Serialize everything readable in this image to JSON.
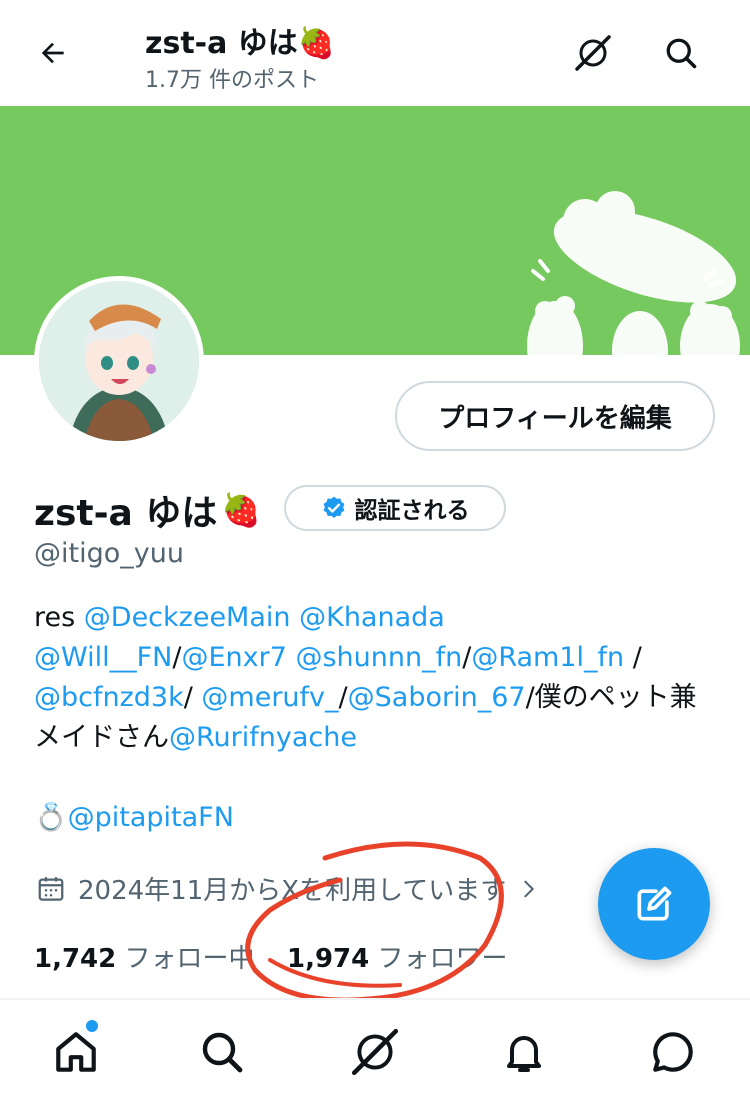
{
  "header": {
    "title": "zst-a ゆは",
    "title_emoji": "🍓",
    "post_count": "1.7万 件のポスト",
    "icons": [
      "back-arrow-icon",
      "grok-icon",
      "search-icon"
    ]
  },
  "profile": {
    "edit_button": "プロフィールを編集",
    "display_name": "zst-a ゆは",
    "name_emoji": "🍓",
    "verified_label": "認証される",
    "handle": "@itigo_yuu"
  },
  "bio": {
    "line1": [
      {
        "text": "res ",
        "link": false
      },
      {
        "text": "@DeckzeeMain",
        "link": true
      },
      {
        "text": " ",
        "link": false
      },
      {
        "text": "@Khanada",
        "link": true
      }
    ],
    "line2": [
      {
        "text": "@Will__FN",
        "link": true
      },
      {
        "text": "/",
        "link": false
      },
      {
        "text": "@Enxr7",
        "link": true
      },
      {
        "text": " ",
        "link": false
      },
      {
        "text": "@shunnn_fn",
        "link": true
      },
      {
        "text": "/",
        "link": false
      },
      {
        "text": "@Ram1l_fn",
        "link": true
      },
      {
        "text": " /",
        "link": false
      }
    ],
    "line3": [
      {
        "text": "@bcfnzd3k",
        "link": true
      },
      {
        "text": "/ ",
        "link": false
      },
      {
        "text": "@merufv_",
        "link": true
      },
      {
        "text": "/",
        "link": false
      },
      {
        "text": "@Saborin_67",
        "link": true
      },
      {
        "text": "/僕のペット兼",
        "link": false
      }
    ],
    "line4": [
      {
        "text": "メイドさん",
        "link": false
      },
      {
        "text": "@Rurifnyache",
        "link": true
      }
    ],
    "line5": [
      {
        "text": "💍",
        "link": false
      },
      {
        "text": "@pitapitaFN",
        "link": true
      }
    ]
  },
  "joined": "2024年11月からXを利用しています",
  "stats": {
    "following_count": "1,742",
    "following_label": "フォロー中",
    "followers_count": "1,974",
    "followers_label": "フォロワー"
  },
  "bottom_nav": [
    "home-icon",
    "search-icon",
    "grok-icon",
    "notifications-icon",
    "messages-icon"
  ],
  "colors": {
    "accent": "#1d9bf0",
    "banner": "#76c95f",
    "annotation": "#e8432a"
  }
}
